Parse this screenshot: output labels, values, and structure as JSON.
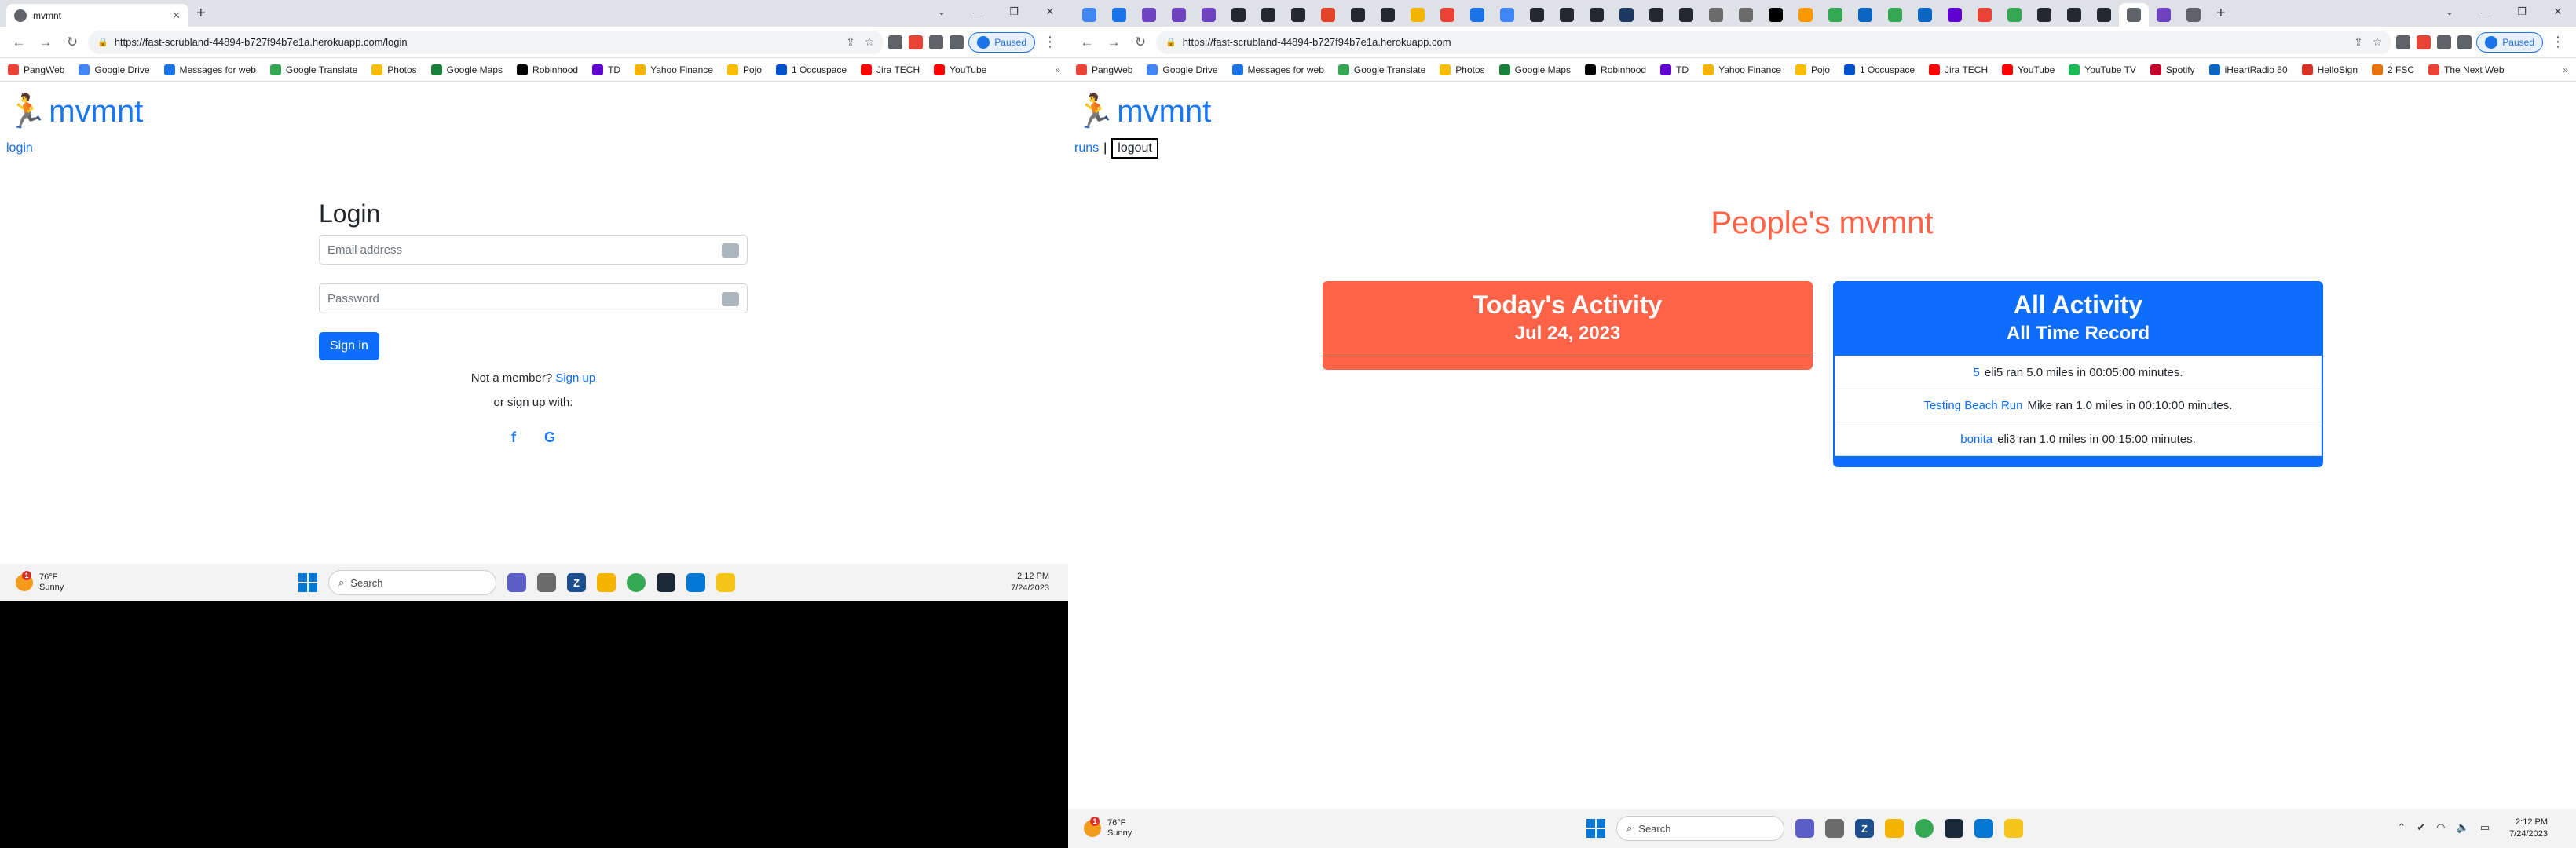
{
  "left": {
    "tab_title": "mvmnt",
    "url": "https://fast-scrubland-44894-b727f94b7e1a.herokuapp.com/login",
    "paused_label": "Paused",
    "bookmarks": [
      "PangWeb",
      "Google Drive",
      "Messages for web",
      "Google Translate",
      "Photos",
      "Google Maps",
      "Robinhood",
      "TD",
      "Yahoo Finance",
      "Pojo",
      "1 Occuspace",
      "Jira TECH",
      "YouTube"
    ],
    "brand": "mvmnt",
    "login_link": "login",
    "login": {
      "title": "Login",
      "email_placeholder": "Email address",
      "password_placeholder": "Password",
      "signin_label": "Sign in",
      "not_member": "Not a member?",
      "signup_label": "Sign up",
      "or_signup_with": "or sign up with:",
      "facebook_glyph": "f",
      "google_glyph": "G"
    },
    "taskbar": {
      "temp": "76°F",
      "condition": "Sunny",
      "search_placeholder": "Search",
      "time": "2:12 PM",
      "date": "7/24/2023"
    }
  },
  "right": {
    "url": "https://fast-scrubland-44894-b727f94b7e1a.herokuapp.com",
    "paused_label": "Paused",
    "bookmarks": [
      "PangWeb",
      "Google Drive",
      "Messages for web",
      "Google Translate",
      "Photos",
      "Google Maps",
      "Robinhood",
      "TD",
      "Yahoo Finance",
      "Pojo",
      "1 Occuspace",
      "Jira TECH",
      "YouTube",
      "YouTube TV",
      "Spotify",
      "iHeartRadio 50",
      "HelloSign",
      "2 FSC",
      "The Next Web"
    ],
    "brand": "mvmnt",
    "nav": {
      "runs": "runs",
      "separator": "|",
      "logout": "logout"
    },
    "headline": "People's mvmnt",
    "today": {
      "title": "Today's Activity",
      "date": "Jul 24, 2023"
    },
    "alltime": {
      "title": "All Activity",
      "subtitle": "All Time Record",
      "items": [
        {
          "run": "5",
          "text": "eli5 ran 5.0 miles in 00:05:00 minutes."
        },
        {
          "run": "Testing Beach Run",
          "text": "Mike ran 1.0 miles in 00:10:00 minutes."
        },
        {
          "run": "bonita",
          "text": "eli3 ran 1.0 miles in 00:15:00 minutes."
        }
      ]
    },
    "taskbar": {
      "temp": "76°F",
      "condition": "Sunny",
      "search_placeholder": "Search",
      "time": "2:12 PM",
      "date": "7/24/2023"
    }
  },
  "colors": {
    "brand_blue": "#1877f2",
    "accent_red": "#ff6347",
    "primary": "#0d6efd"
  }
}
